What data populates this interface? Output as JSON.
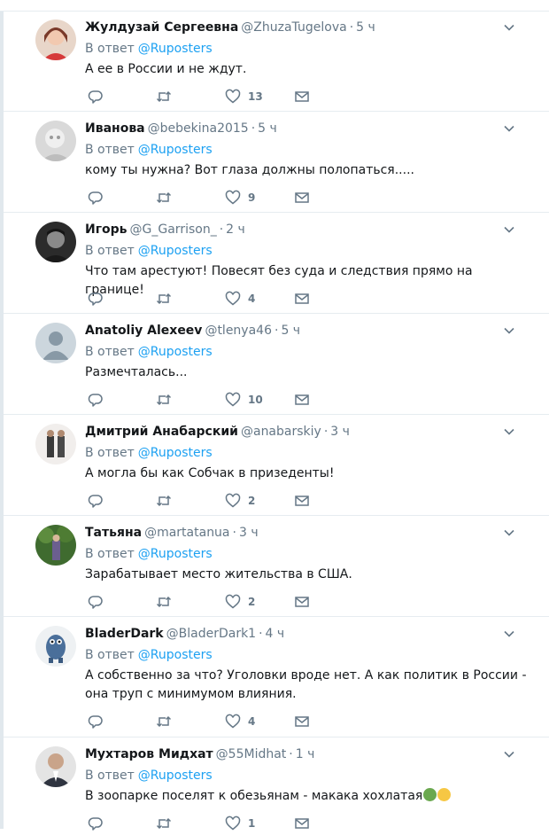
{
  "reply_prefix": "В ответ",
  "colors": {
    "link": "#1da1f2",
    "muted": "#657786",
    "text": "#14171a",
    "divider": "#e6ecf0"
  },
  "icons": {
    "reply": "reply-icon",
    "retweet": "retweet-icon",
    "like": "heart-icon",
    "dm": "envelope-icon",
    "menu": "chevron-down-icon"
  },
  "tweets": [
    {
      "name": "Жулдузай Сергеевна",
      "handle": "@ZhuzaTugelova",
      "time": "5 ч",
      "reply_to": "@Ruposters",
      "text": "А ее в России и не ждут.",
      "likes": "13"
    },
    {
      "name": "Иванова",
      "handle": "@bebekina2015",
      "time": "5 ч",
      "reply_to": "@Ruposters",
      "text": "кому ты нужна? Вот глаза должны полопаться.....",
      "likes": "9"
    },
    {
      "name": "Игорь",
      "handle": "@G_Garrison_",
      "time": "2 ч",
      "reply_to": "@Ruposters",
      "text": "Что там арестуют! Повесят без суда и следствия прямо на границе!",
      "likes": "4"
    },
    {
      "name": "Anatoliy Alexeev",
      "handle": "@tlenya46",
      "time": "5 ч",
      "reply_to": "@Ruposters",
      "text": "Размечталась...",
      "likes": "10"
    },
    {
      "name": "Дмитрий Анабарский",
      "handle": "@anabarskiy",
      "time": "3 ч",
      "reply_to": "@Ruposters",
      "text": "А могла бы как Собчак в призеденты!",
      "likes": "2"
    },
    {
      "name": "Татьяна",
      "handle": "@martatanua",
      "time": "3 ч",
      "reply_to": "@Ruposters",
      "text": "Зарабатывает место жительства в США.",
      "likes": "2"
    },
    {
      "name": "BladerDark",
      "handle": "@BladerDark1",
      "time": "4 ч",
      "reply_to": "@Ruposters",
      "text": "А собственно за что? Уголовки вроде нет. А как политик в России - она труп с минимумом влияния.",
      "likes": "4"
    },
    {
      "name": "Мухтаров Мидхат",
      "handle": "@55Midhat",
      "time": "1 ч",
      "reply_to": "@Ruposters",
      "text": "В зоопарке поселят к обезьянам - макака хохлатая",
      "likes": "1"
    }
  ]
}
